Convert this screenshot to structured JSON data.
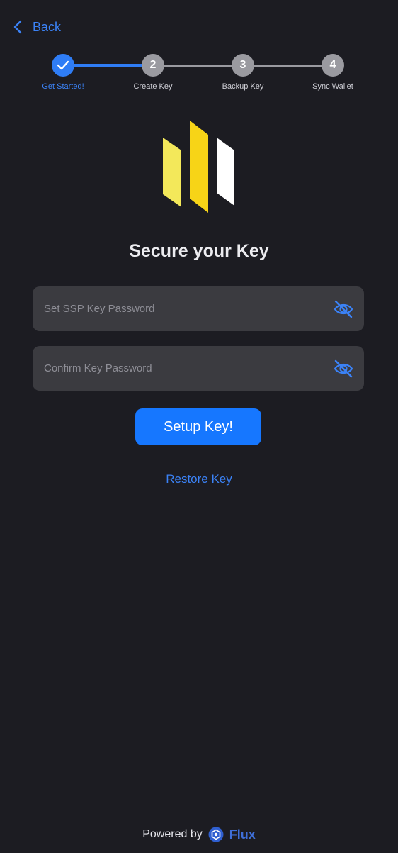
{
  "nav": {
    "back_label": "Back"
  },
  "stepper": {
    "steps": [
      {
        "number": "1",
        "label": "Get Started!",
        "state": "done"
      },
      {
        "number": "2",
        "label": "Create Key",
        "state": "pending"
      },
      {
        "number": "3",
        "label": "Backup Key",
        "state": "pending"
      },
      {
        "number": "4",
        "label": "Sync Wallet",
        "state": "pending"
      }
    ]
  },
  "main": {
    "title": "Secure your Key",
    "password_field": {
      "placeholder": "Set SSP Key Password",
      "value": ""
    },
    "confirm_field": {
      "placeholder": "Confirm Key Password",
      "value": ""
    },
    "setup_button": "Setup Key!",
    "restore_link": "Restore Key"
  },
  "footer": {
    "powered_by": "Powered by",
    "brand": "Flux"
  },
  "colors": {
    "background": "#1c1c22",
    "accent": "#1677ff",
    "link": "#3b82f6",
    "logo_yellow_light": "#f3e85a",
    "logo_yellow": "#f7d417",
    "logo_white": "#ffffff"
  },
  "icons": {
    "back": "chevron-left-icon",
    "step_done": "check-icon",
    "password_toggle": "eye-off-icon",
    "brand": "flux-logo-icon"
  }
}
